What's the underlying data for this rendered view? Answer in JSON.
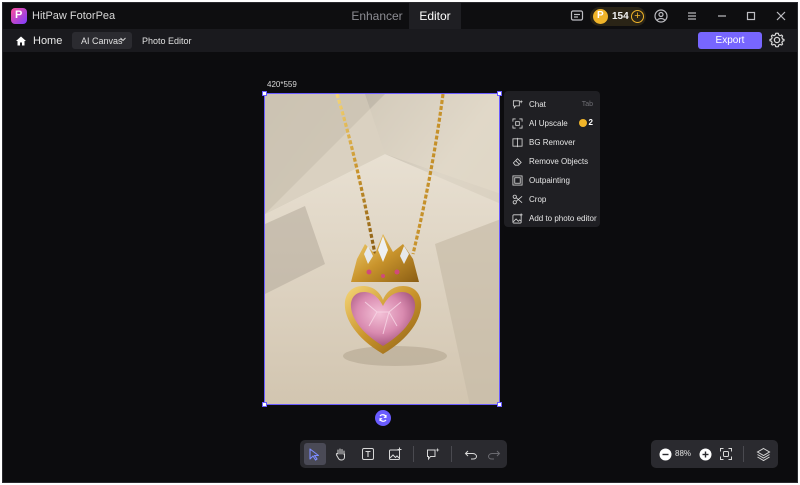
{
  "app": {
    "name": "HitPaw FotorPea"
  },
  "mode_tabs": [
    {
      "label": "Enhancer",
      "active": false
    },
    {
      "label": "Editor",
      "active": true
    }
  ],
  "credits": {
    "count": "154"
  },
  "nav": {
    "home_label": "Home",
    "canvas_select": "AI Canvas",
    "current_page": "Photo Editor",
    "export_label": "Export"
  },
  "canvas": {
    "size_label": "420*559",
    "image_subject": "gold crown pendant with pink heart gemstone in a jewelry box"
  },
  "context_menu": {
    "items": [
      {
        "label": "Chat",
        "shortcut": "Tab",
        "icon": "chat-sparkle-icon"
      },
      {
        "label": "AI Upscale",
        "credit": "2",
        "icon": "upscale-icon"
      },
      {
        "label": "BG Remover",
        "icon": "bg-remover-icon"
      },
      {
        "label": "Remove Objects",
        "icon": "eraser-icon"
      },
      {
        "label": "Outpainting",
        "icon": "outpainting-icon"
      },
      {
        "label": "Crop",
        "icon": "scissors-icon"
      },
      {
        "label": "Add to photo editor",
        "icon": "add-image-icon"
      }
    ]
  },
  "zoom": {
    "value": "88%"
  },
  "colors": {
    "accent": "#7766ff",
    "selection": "#6a5cff",
    "coin": "#f0b429",
    "background": "#0c0c0e"
  }
}
